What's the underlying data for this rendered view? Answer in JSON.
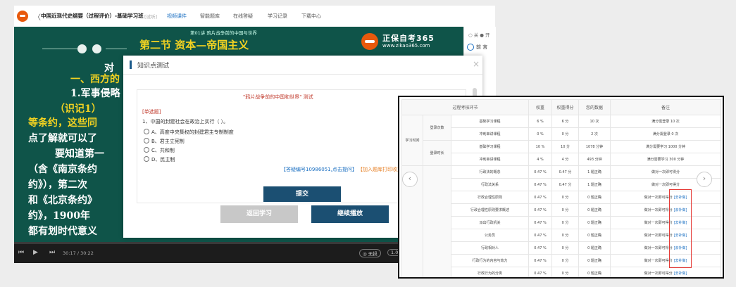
{
  "nav": {
    "back": "〈",
    "course_title": "中国近现代史纲要（过程评价）-基础学习班",
    "trial": "[试听]",
    "tabs": [
      "视频课件",
      "智能题库",
      "在线答疑",
      "学习记录",
      "下载中心"
    ]
  },
  "side": {
    "item1": "○ 关 ● 开",
    "item2": "前 言"
  },
  "video": {
    "lecture_caption": "第01讲  鸦片战争前的中国与世界",
    "section_title": "第二节  资本—帝国主义",
    "brand_name": "正保自考365",
    "brand_url": "www.zikao365.com",
    "lines": [
      "对",
      "一、西方的",
      "1.军事侵略",
      "（识记1）",
      "等条约，这些同",
      "点了解就可以了",
      "要知道第一",
      "（含《南京条约",
      "约》），第二次",
      "和《北京条约》",
      "约》，1900年",
      "都有划时代意义"
    ],
    "time_current": "30:17",
    "time_sep": "/",
    "time_total": "30:22",
    "speed_label": "◎ 无损",
    "rate_label": "1.0"
  },
  "quiz": {
    "title": "知识点测试",
    "close": "×",
    "heading": "\"鸦片战争前的中国和世界\" 测试",
    "question_type": "[单选题]",
    "question": "1、中国的封建社会在政治上实行（  ）。",
    "options": [
      "A、高度中央集权的封建君主专制制度",
      "B、君主立宪制",
      "C、共和制",
      "D、民主制"
    ],
    "answer_link": "【答疑编号10986051,点击提问】",
    "add_link": "【加入题库打印收】",
    "submit": "提交",
    "return": "返回学习",
    "continue": "继续播放"
  },
  "records": {
    "headers": [
      "过程考核环节",
      "权重",
      "权重得分",
      "您的数据",
      "备注"
    ],
    "group": "学习时间",
    "sub_groups": [
      "登录次数",
      "登录时长"
    ],
    "rows": [
      {
        "item": "基础学习课程",
        "weight": "6 %",
        "score": "6 分",
        "data": "10 次",
        "note": "满分需登录 10 次"
      },
      {
        "item": "冲刺串讲课程",
        "weight": "0 %",
        "score": "0 分",
        "data": "2 次",
        "note": "满分需登录 0 次"
      },
      {
        "item": "基础学习课程",
        "weight": "10 %",
        "score": "10 分",
        "data": "1078 分钟",
        "note": "满分需要学习 1000 分钟"
      },
      {
        "item": "冲刺串讲课程",
        "weight": "4 %",
        "data": "493 分钟",
        "score": "4 分",
        "note": "满分需要学习 300 分钟"
      },
      {
        "item": "行政法的概念",
        "weight": "0.47 %",
        "score": "0.47 分",
        "data": "1 题正确",
        "note": "做对一次即可得分"
      },
      {
        "item": "行政法关系",
        "weight": "0.47 %",
        "score": "0.47 分",
        "data": "1 题正确",
        "note": "做对一次即可得分"
      },
      {
        "item": "行政合理性原则",
        "weight": "0.47 %",
        "score": "0 分",
        "data": "0 题正确",
        "note": "做对一次即可得分",
        "add": "[去补做]"
      },
      {
        "item": "行政合理性原则要求概述",
        "weight": "0.47 %",
        "score": "0 分",
        "data": "0 题正确",
        "note": "做对一次即可得分",
        "add": "[去补做]"
      },
      {
        "item": "派出行政机关",
        "weight": "0.47 %",
        "score": "0 分",
        "data": "0 题正确",
        "note": "做对一次即可得分",
        "add": "[去补做]"
      },
      {
        "item": "公务员",
        "weight": "0.47 %",
        "score": "0 分",
        "data": "0 题正确",
        "note": "做对一次即可得分",
        "add": "[去补做]"
      },
      {
        "item": "行政相对人",
        "weight": "0.47 %",
        "score": "0 分",
        "data": "0 题正确",
        "note": "做对一次即可得分",
        "add": "[去补做]"
      },
      {
        "item": "行政行为的内容与效力",
        "weight": "0.47 %",
        "score": "0 分",
        "data": "0 题正确",
        "note": "做对一次即可得分",
        "add": "[去补做]"
      },
      {
        "item": "行政行为的分类",
        "weight": "0.47 %",
        "score": "0 分",
        "data": "0 题正确",
        "note": "做对一次即可得分",
        "add": "[去补做]"
      }
    ],
    "prev": "‹",
    "next": "›"
  }
}
